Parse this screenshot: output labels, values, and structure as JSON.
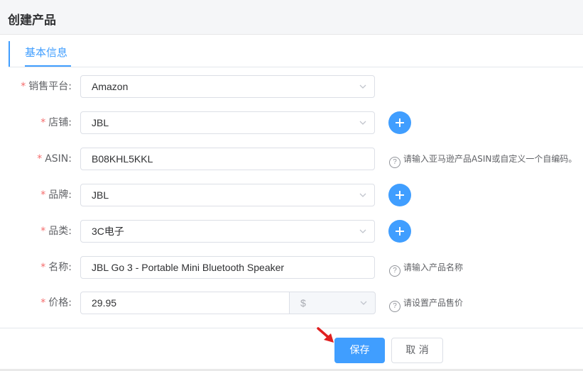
{
  "page": {
    "title": "创建产品"
  },
  "tabs": [
    {
      "label": "基本信息",
      "active": true
    }
  ],
  "form": {
    "platform": {
      "label": "销售平台:",
      "value": "Amazon",
      "required": "*"
    },
    "store": {
      "label": "店铺:",
      "value": "JBL",
      "required": "*"
    },
    "asin": {
      "label": "ASIN:",
      "value": "B08KHL5KKL",
      "required": "*",
      "hint": "请输入亚马逊产品ASIN或自定义一个自编码。"
    },
    "brand": {
      "label": "品牌:",
      "value": "JBL",
      "required": "*"
    },
    "category": {
      "label": "品类:",
      "value": "3C电子",
      "required": "*"
    },
    "name": {
      "label": "名称:",
      "value": "JBL Go 3 - Portable Mini Bluetooth Speaker",
      "required": "*",
      "hint": "请输入产品名称"
    },
    "price": {
      "label": "价格:",
      "value": "29.95",
      "currency": "$",
      "required": "*",
      "hint": "请设置产品售价"
    }
  },
  "hint_icon": "?",
  "actions": {
    "save_label": "保存",
    "cancel_label": "取 消"
  },
  "colors": {
    "primary": "#409eff",
    "required": "#f56c6c",
    "annotation_arrow": "#e02020"
  },
  "icons": {
    "add": "plus-circle-icon",
    "dropdown": "chevron-down-icon",
    "help": "question-circle-icon"
  }
}
